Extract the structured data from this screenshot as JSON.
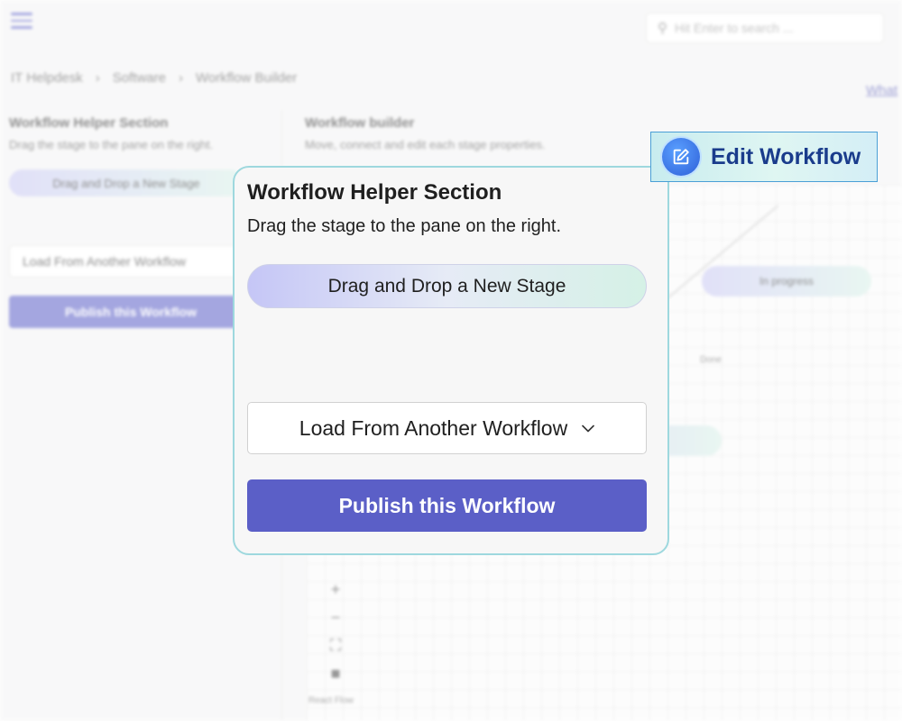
{
  "background": {
    "search": {
      "placeholder": "Hit Enter to search ..."
    },
    "breadcrumb": [
      "IT Helpdesk",
      "Software",
      "Workflow Builder"
    ],
    "help_link": "What",
    "left": {
      "title": "Workflow Helper Section",
      "subtitle": "Drag the stage to the pane on the right.",
      "stage_label": "Drag and Drop a New Stage",
      "load_label": "Load From Another Workflow",
      "publish_label": "Publish this Workflow"
    },
    "right": {
      "title": "Workflow builder",
      "subtitle": "Move, connect and edit each stage properties."
    },
    "canvas": {
      "nodes": [
        "In progress"
      ],
      "edge_label": "Done",
      "attribution": "React Flow"
    }
  },
  "callout": {
    "label": "Edit Workflow",
    "icon": "edit-icon"
  },
  "panel": {
    "title": "Workflow Helper Section",
    "subtitle": "Drag the stage to the pane on the right.",
    "stage_button": "Drag and Drop a New Stage",
    "load_select": "Load From Another Workflow",
    "publish_button": "Publish this Workflow"
  },
  "colors": {
    "accent": "#5b5fc7",
    "panel_border": "#9ed8de",
    "callout_text": "#1a3c8c"
  }
}
